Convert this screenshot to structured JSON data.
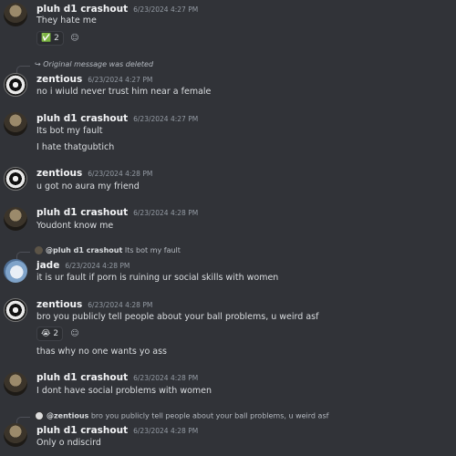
{
  "messages": [
    {
      "author": "pluh d1 crashout",
      "time": "6/23/2024 4:27 PM",
      "lines": [
        "They hate me"
      ],
      "reaction": {
        "emoji": "✅",
        "count": "2"
      }
    },
    {
      "reply": "Original message was deleted",
      "author": "zentious",
      "time": "6/23/2024 4:27 PM",
      "lines": [
        "no i wiuld never trust him near a female"
      ]
    },
    {
      "author": "pluh d1 crashout",
      "time": "6/23/2024 4:27 PM",
      "lines": [
        "Its bot my fault",
        "I hate thatgubtich"
      ]
    },
    {
      "author": "zentious",
      "time": "6/23/2024 4:28 PM",
      "lines": [
        "u got no aura my friend"
      ]
    },
    {
      "author": "pluh d1 crashout",
      "time": "6/23/2024 4:28 PM",
      "lines": [
        "Youdont know me"
      ]
    },
    {
      "reply_name": "@pluh d1 crashout",
      "reply_text": "Its bot my fault",
      "author": "jade",
      "time": "6/23/2024 4:28 PM",
      "lines": [
        "it is ur fault if porn is ruining ur social skills with women"
      ]
    },
    {
      "author": "zentious",
      "time": "6/23/2024 4:28 PM",
      "lines": [
        "bro you publicly tell people about your ball problems, u weird asf"
      ],
      "reaction": {
        "emoji": "😭",
        "count": "2"
      },
      "extra": "thas why no one wants yo ass"
    },
    {
      "author": "pluh d1 crashout",
      "time": "6/23/2024 4:28 PM",
      "lines": [
        "I dont have social problems with women"
      ]
    },
    {
      "reply_name": "@zentious",
      "reply_text": "bro you publicly tell people about your ball problems, u weird asf",
      "author": "pluh d1 crashout",
      "time": "6/23/2024 4:28 PM",
      "lines": [
        "Only o ndiscird"
      ]
    }
  ]
}
